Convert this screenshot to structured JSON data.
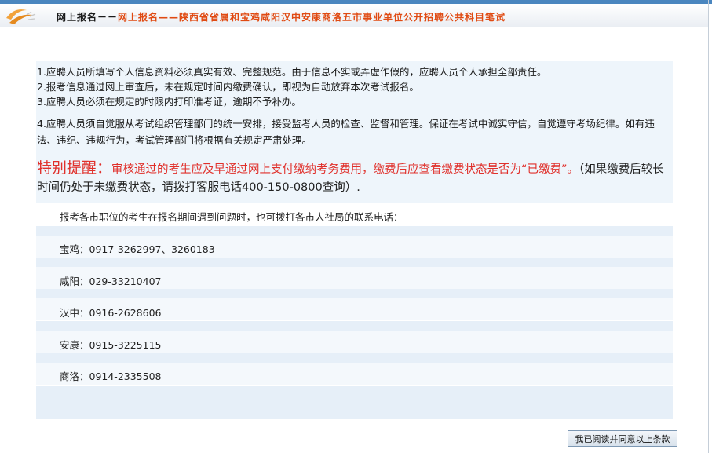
{
  "header": {
    "section": "网上报名－－",
    "title": "网上报名——陕西省省属和宝鸡咸阳汉中安康商洛五市事业单位公开招聘公共科目笔试"
  },
  "notice": {
    "items": [
      "1.应聘人员所填写个人信息资料必须真实有效、完整规范。由于信息不实或弄虚作假的，应聘人员个人承担全部责任。",
      "2.报考信息通过网上审查后，未在规定时间内缴费确认，即视为自动放弃本次考试报名。",
      "3.应聘人员必须在规定的时限内打印准考证，逾期不予补办。",
      "4.应聘人员须自觉服从考试组织管理部门的统一安排，接受监考人员的检查、监督和管理。保证在考试中诚实守信，自觉遵守考场纪律。如有违法、违纪、违规行为，考试管理部门将根据有关规定严肃处理。"
    ],
    "special_label": "特别提醒：",
    "special_red": "审核通过的考生应及早通过网上支付缴纳考务费用，缴费后应查看缴费状态是否为“已缴费”。",
    "special_rest": "（如果缴费后较长时间仍处于未缴费状态，请拨打客服电话400-150-0800查询）."
  },
  "contacts": {
    "intro": "报考各市职位的考生在报名期间遇到问题时，也可拨打各市人社局的联系电话：",
    "list": [
      "宝鸡：0917-3262997、3260183",
      "咸阳：029-33210407",
      "汉中：0916-2628606",
      "安康：0915-3225115",
      "商洛：0914-2335508"
    ]
  },
  "agree_button": "我已阅读并同意以上条款",
  "colors": {
    "accent_red": "#e0302b",
    "header_orange": "#e04a12",
    "panel_bg": "#eef5fb"
  }
}
